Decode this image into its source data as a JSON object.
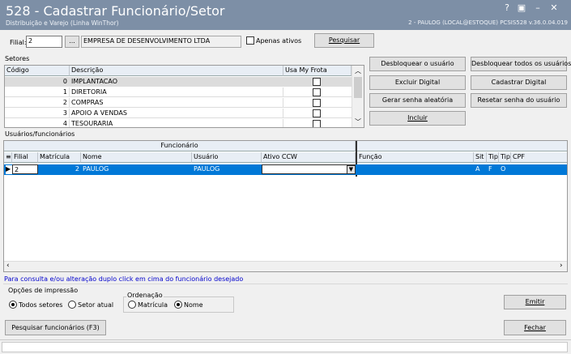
{
  "window": {
    "title": "528 - Cadastrar Funcionário/Setor",
    "subtitle": "Distribuição e Varejo (Linha WinThor)",
    "user_info": "2 - PAULOG (LOCAL@ESTOQUE)   PCSIS528  v.36.0.04.019",
    "btn_help": "?",
    "btn_restore": "▣",
    "btn_min": "–",
    "btn_close": "✕"
  },
  "filter": {
    "filial_label": "Filial:",
    "filial_value": "2",
    "lookup_label": "...",
    "empresa_value": "EMPRESA DE DESENVOLVIMENTO LTDA",
    "apenas_ativos_label": "Apenas ativos",
    "pesquisar_label": "Pesquisar"
  },
  "setores": {
    "section_label": "Setores",
    "columns": [
      "Código",
      "Descrição",
      "Usa My Frota"
    ],
    "rows": [
      {
        "codigo": "0",
        "descricao": "IMPLANTACAO"
      },
      {
        "codigo": "1",
        "descricao": "DIRETORIA"
      },
      {
        "codigo": "2",
        "descricao": "COMPRAS"
      },
      {
        "codigo": "3",
        "descricao": "APOIO A VENDAS"
      },
      {
        "codigo": "4",
        "descricao": "TESOURARIA"
      }
    ]
  },
  "actions": {
    "desbloquear_usuario": "Desbloquear o usuário",
    "desbloquear_todos": "Desbloquear todos os usuários",
    "excluir_digital": "Excluir Digital",
    "cadastrar_digital": "Cadastrar Digital",
    "gerar_senha": "Gerar senha aleatória",
    "resetar_senha": "Resetar senha do usuário",
    "incluir": "Incluir"
  },
  "usuarios": {
    "section_label": "Usuários/funcionários",
    "group_header": "Funcionário",
    "columns": [
      "Filial",
      "Matrícula",
      "Nome",
      "Usuário",
      "Ativo CCW",
      "Função",
      "Sit",
      "Tip",
      "Tip",
      "CPF"
    ],
    "rows": [
      {
        "filial": "2",
        "matricula": "2",
        "nome": "PAULOG",
        "usuario": "PAULOG",
        "ativo_ccw": "",
        "funcao": "",
        "sit": "A",
        "tip1": "F",
        "tip2": "O",
        "cpf": ""
      }
    ]
  },
  "hint": "Para consulta e/ou alteração duplo click em cima do funcionário desejado",
  "impressao": {
    "label": "Opções de impressão",
    "todos_setores": "Todos setores",
    "setor_atual": "Setor atual",
    "ordenacao_label": "Ordenação",
    "matricula": "Matrícula",
    "nome": "Nome",
    "emitir": "Emitir"
  },
  "footer": {
    "pesquisar_funcionarios": "Pesquisar funcionários (F3)",
    "fechar": "Fechar"
  },
  "colors": {
    "titlebar": "#7d8fa6",
    "selection": "#0078d7",
    "hint_text": "#0000cc"
  }
}
